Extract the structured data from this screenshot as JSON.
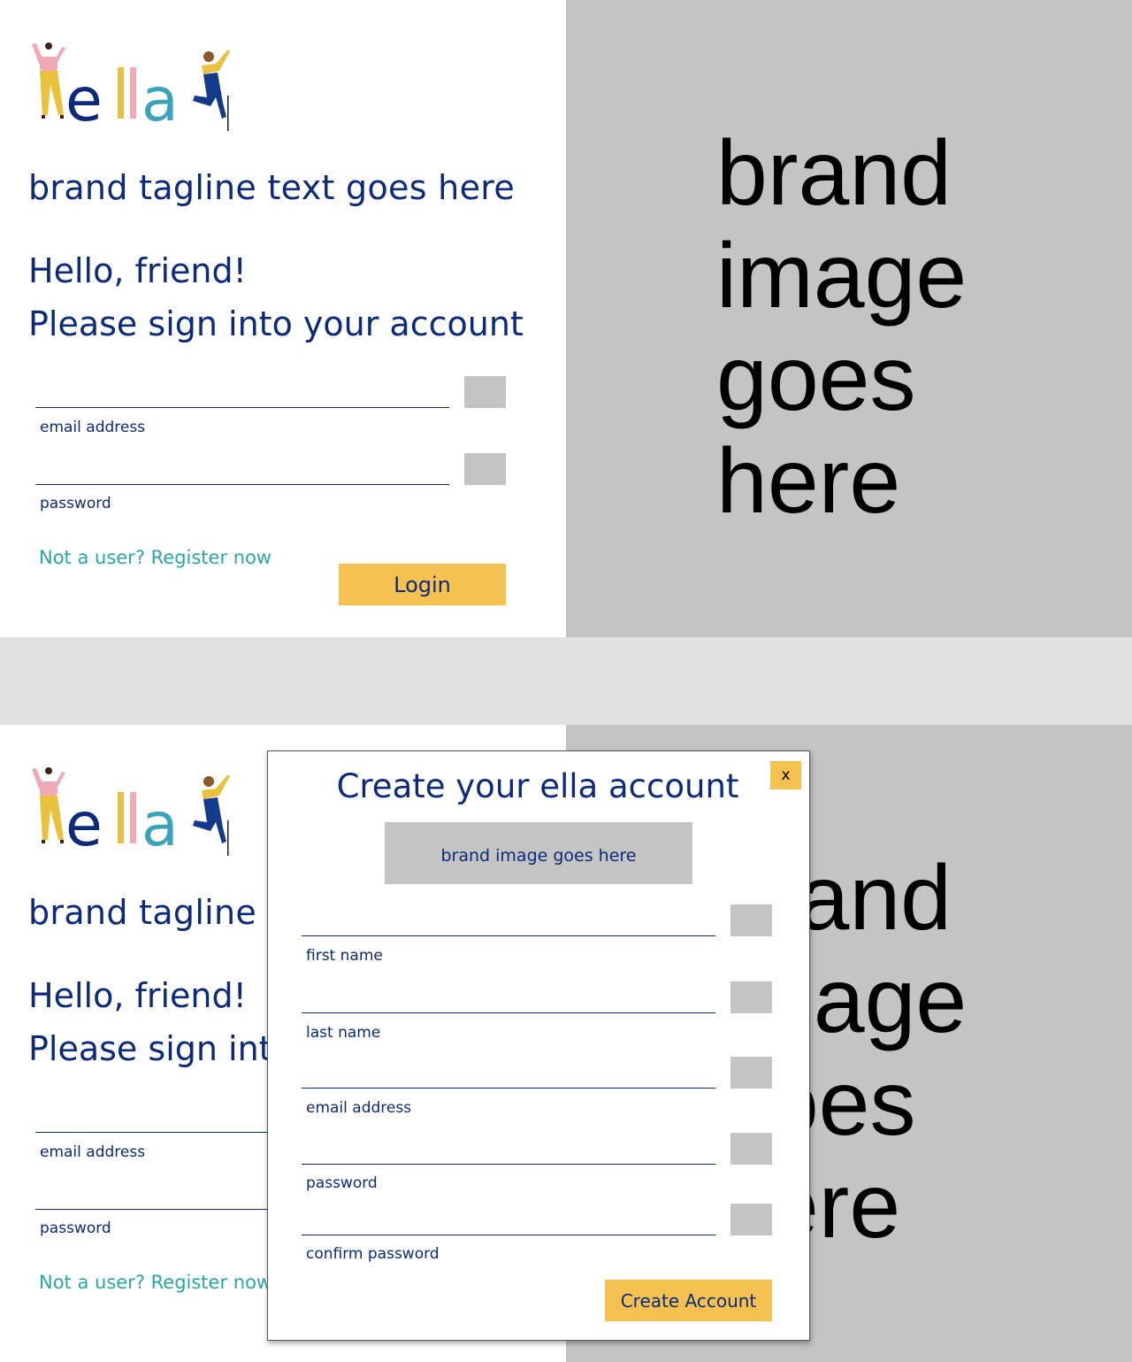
{
  "login": {
    "tagline": "brand tagline text goes here",
    "greeting": "Hello, friend!",
    "subtitle": "Please sign into your account",
    "email_label": "email address",
    "password_label": "password",
    "register_link": "Not a user? Register now",
    "login_button": "Login",
    "brand_image_lines": [
      "brand",
      "image",
      "goes",
      "here"
    ]
  },
  "logo": {
    "text": "ella",
    "name": "ella-logo"
  },
  "modal": {
    "title": "Create your ella account",
    "close_label": "x",
    "brand_placeholder": "brand image goes here",
    "fields": [
      {
        "label": "first name"
      },
      {
        "label": "last name"
      },
      {
        "label": "email address"
      },
      {
        "label": "password"
      },
      {
        "label": "confirm password"
      }
    ],
    "submit_label": "Create Account"
  },
  "colors": {
    "navy": "#0d2a7a",
    "accent_yellow": "#f5c150",
    "teal": "#2aa5a8",
    "placeholder_gray": "#c4c4c4",
    "logo_pink": "#f2a9b6"
  }
}
